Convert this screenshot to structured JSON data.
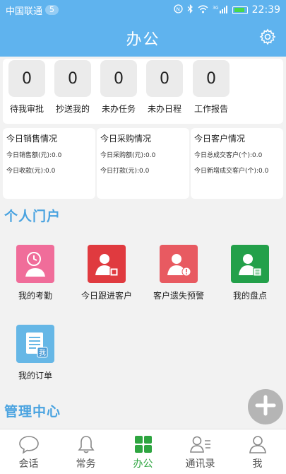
{
  "status_bar": {
    "carrier": "中国联通",
    "notification_count": "5",
    "signal_label": "3G",
    "time": "22:39"
  },
  "header": {
    "title": "办公"
  },
  "stats": [
    {
      "value": "0",
      "label": "待我审批"
    },
    {
      "value": "0",
      "label": "抄送我的"
    },
    {
      "value": "0",
      "label": "未办任务"
    },
    {
      "value": "0",
      "label": "未办日程"
    },
    {
      "value": "0",
      "label": "工作报告"
    }
  ],
  "summary_cards": [
    {
      "title": "今日销售情况",
      "rows": [
        "今日销售额(元):0.0",
        "今日收款(元):0.0"
      ]
    },
    {
      "title": "今日采购情况",
      "rows": [
        "今日采购额(元):0.0",
        "今日打款(元):0.0"
      ]
    },
    {
      "title": "今日客户情况",
      "rows": [
        "今日总成交客户(个):0.0",
        "今日新增成交客户(个):0.0"
      ]
    }
  ],
  "personal_portal": {
    "title": "个人门户",
    "tiles": [
      {
        "label": "我的考勤",
        "icon": "clock-person-icon",
        "color": "#f06d9a"
      },
      {
        "label": "今日跟进客户",
        "icon": "person-follow-icon",
        "color": "#e03a3f"
      },
      {
        "label": "客户遗失预警",
        "icon": "person-warning-icon",
        "color": "#e85a61"
      },
      {
        "label": "我的盘点",
        "icon": "person-inventory-icon",
        "color": "#23a04a"
      },
      {
        "label": "我的订单",
        "icon": "order-document-icon",
        "color": "#66b7e6",
        "badge": "我"
      }
    ]
  },
  "management_center": {
    "title": "管理中心"
  },
  "tabbar": [
    {
      "label": "会话",
      "icon": "chat-bubble-icon",
      "active": false
    },
    {
      "label": "常务",
      "icon": "bell-icon",
      "active": false
    },
    {
      "label": "办公",
      "icon": "grid-icon",
      "active": true
    },
    {
      "label": "通讯录",
      "icon": "contacts-icon",
      "active": false
    },
    {
      "label": "我",
      "icon": "person-icon",
      "active": false
    }
  ],
  "colors": {
    "primary": "#5fb3ee",
    "section_title": "#4aa3e0",
    "active_tab": "#2ea540"
  }
}
